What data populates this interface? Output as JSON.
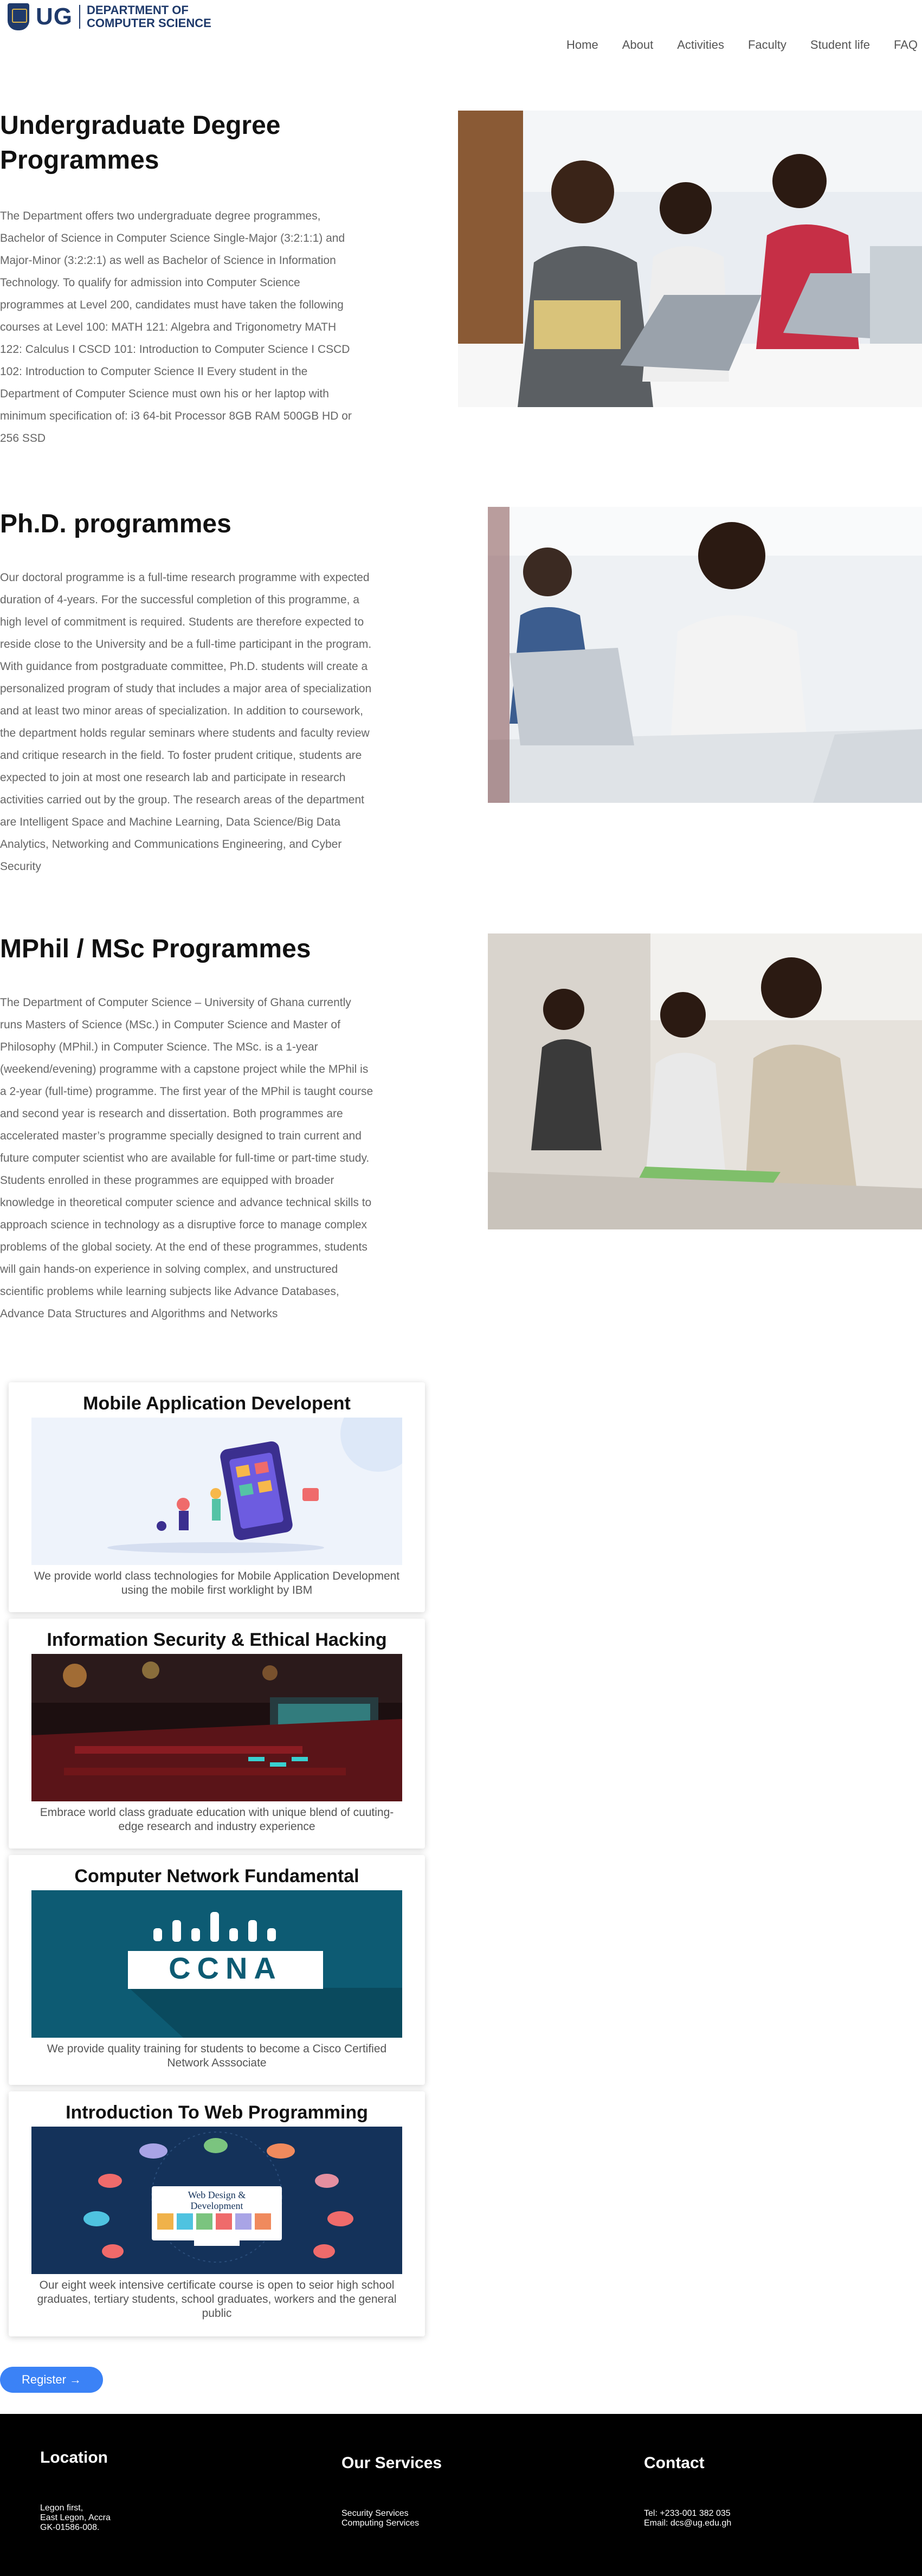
{
  "header": {
    "logo_text": "UG",
    "dept_line1": "DEPARTMENT OF",
    "dept_line2": "COMPUTER SCIENCE",
    "nav": [
      "Home",
      "About",
      "Activities",
      "Faculty",
      "Student life",
      "FAQ"
    ]
  },
  "undergrad": {
    "title_line1": "Undergraduate Degree",
    "title_line2": "Programmes",
    "lines": [
      "The Department offers two undergraduate degree programmes,",
      "Bachelor of Science in Computer Science Single-Major (3:2:1:1) and",
      "Major-Minor (3:2:2:1) as well as Bachelor of Science in Information",
      "Technology. To qualify for admission into Computer Science",
      "programmes at Level 200, candidates must have taken the following",
      "courses at Level 100: MATH 121: Algebra and Trigonometry MATH",
      "122: Calculus I CSCD 101: Introduction to Computer Science I CSCD",
      "102: Introduction to Computer Science II Every student in the",
      "Department of Computer Science must own his or her laptop with",
      "minimum specification of: i3 64-bit Processor 8GB RAM 500GB HD or",
      "256 SSD"
    ]
  },
  "phd": {
    "title": "Ph.D. programmes",
    "lines": [
      "Our doctoral programme is a full-time research programme with expected",
      "duration of 4-years. For the successful completion of this programme, a",
      "high level of commitment is required. Students are therefore expected to",
      "reside close to the University and be a full-time participant in the program.",
      "With guidance from postgraduate committee, Ph.D. students will create a",
      "personalized program of study that includes a major area of specialization",
      "and at least two minor areas of specialization. In addition to coursework,",
      "the department holds regular seminars where students and faculty review",
      "and critique research in the field. To foster prudent critique, students are",
      "expected to join at most one research lab and participate in research",
      "activities carried out by the group. The research areas of the department",
      "are Intelligent Space and Machine Learning, Data Science/Big Data",
      "Analytics, Networking and Communications Engineering, and Cyber",
      "Security"
    ]
  },
  "mphil": {
    "title": "MPhil / MSc Programmes",
    "lines": [
      "The Department of Computer Science – University of Ghana currently",
      "runs Masters of Science (MSc.) in Computer Science and Master of",
      "Philosophy (MPhil.) in Computer Science. The MSc. is a 1-year",
      "(weekend/evening) programme with a capstone project while the MPhil is",
      "a 2-year (full-time) programme. The first year of the MPhil is taught course",
      "and second year is research and dissertation. Both programmes are",
      "accelerated master’s programme specially designed to train current and",
      "future computer scientist who are available for full-time or part-time study.",
      "Students enrolled in these programmes are equipped with broader",
      "knowledge in theoretical computer science and advance technical skills to",
      "approach science in technology as a disruptive force to manage complex",
      "problems of the global society. At the end of these programmes, students",
      "will gain hands-on experience in solving complex, and unstructured",
      "scientific problems while learning subjects like Advance Databases,",
      "Advance Data Structures and Algorithms and Networks"
    ]
  },
  "cards": [
    {
      "title": "Mobile Application Developent",
      "desc_line1": "We provide world class technologies for Mobile Application Development",
      "desc_line2": "using the mobile first worklight by IBM",
      "desc_line3": ""
    },
    {
      "title": "Information Security & Ethical Hacking",
      "desc_line1": "Embrace world class graduate education with unique blend of cuuting-",
      "desc_line2": "edge research and industry experience",
      "desc_line3": ""
    },
    {
      "title": "Computer Network Fundamental",
      "desc_line1": "We provide quality training for students to become a Cisco Certified",
      "desc_line2": "Network Asssociate",
      "desc_line3": "",
      "image_text": "CCNA"
    },
    {
      "title": "Introduction To Web Programming",
      "desc_line1": "Our eight week intensive certificate course is open to seior high school",
      "desc_line2": "graduates, tertiary students, school graduates, workers and the general",
      "desc_line3": "public",
      "image_text_1": "Web Design &",
      "image_text_2": "Development"
    }
  ],
  "register": {
    "label": "Register →"
  },
  "footer": {
    "location": {
      "heading": "Location",
      "line1": "Legon first,",
      "line2": "East Legon, Accra",
      "line3": "GK-01586-008."
    },
    "services": {
      "heading": "Our Services",
      "line1": "Security Services",
      "line2": "Computing Services"
    },
    "contact": {
      "heading": "Contact",
      "line1": "Tel: +233-001 382 035",
      "line2": "Email: dcs@ug.edu.gh"
    }
  },
  "colors": {
    "brand_navy": "#1f3a6b",
    "button_blue": "#3b82f6",
    "footer_bg": "#000000"
  }
}
